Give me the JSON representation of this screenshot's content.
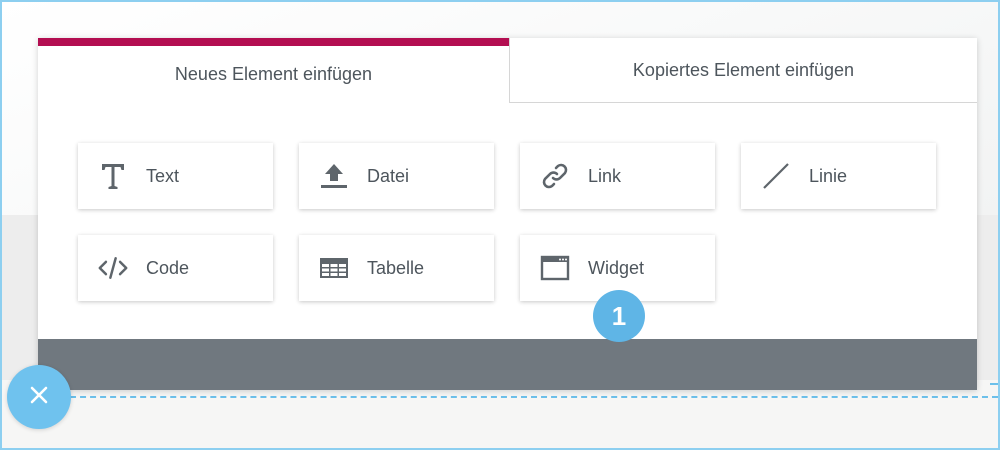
{
  "tabs": {
    "new_element": "Neues Element einfügen",
    "copied_element": "Kopiertes Element einfügen"
  },
  "elements": [
    {
      "label": "Text",
      "icon": "text-icon"
    },
    {
      "label": "Datei",
      "icon": "upload-icon"
    },
    {
      "label": "Link",
      "icon": "link-icon"
    },
    {
      "label": "Linie",
      "icon": "line-icon"
    },
    {
      "label": "Code",
      "icon": "code-icon"
    },
    {
      "label": "Tabelle",
      "icon": "table-icon"
    },
    {
      "label": "Widget",
      "icon": "widget-icon"
    }
  ],
  "badge": {
    "number": "1"
  },
  "colors": {
    "active_tab_accent": "#b30e51",
    "footer_bar": "#70787f",
    "badge": "#5fb5e6",
    "close_button": "#6fc2ee"
  }
}
